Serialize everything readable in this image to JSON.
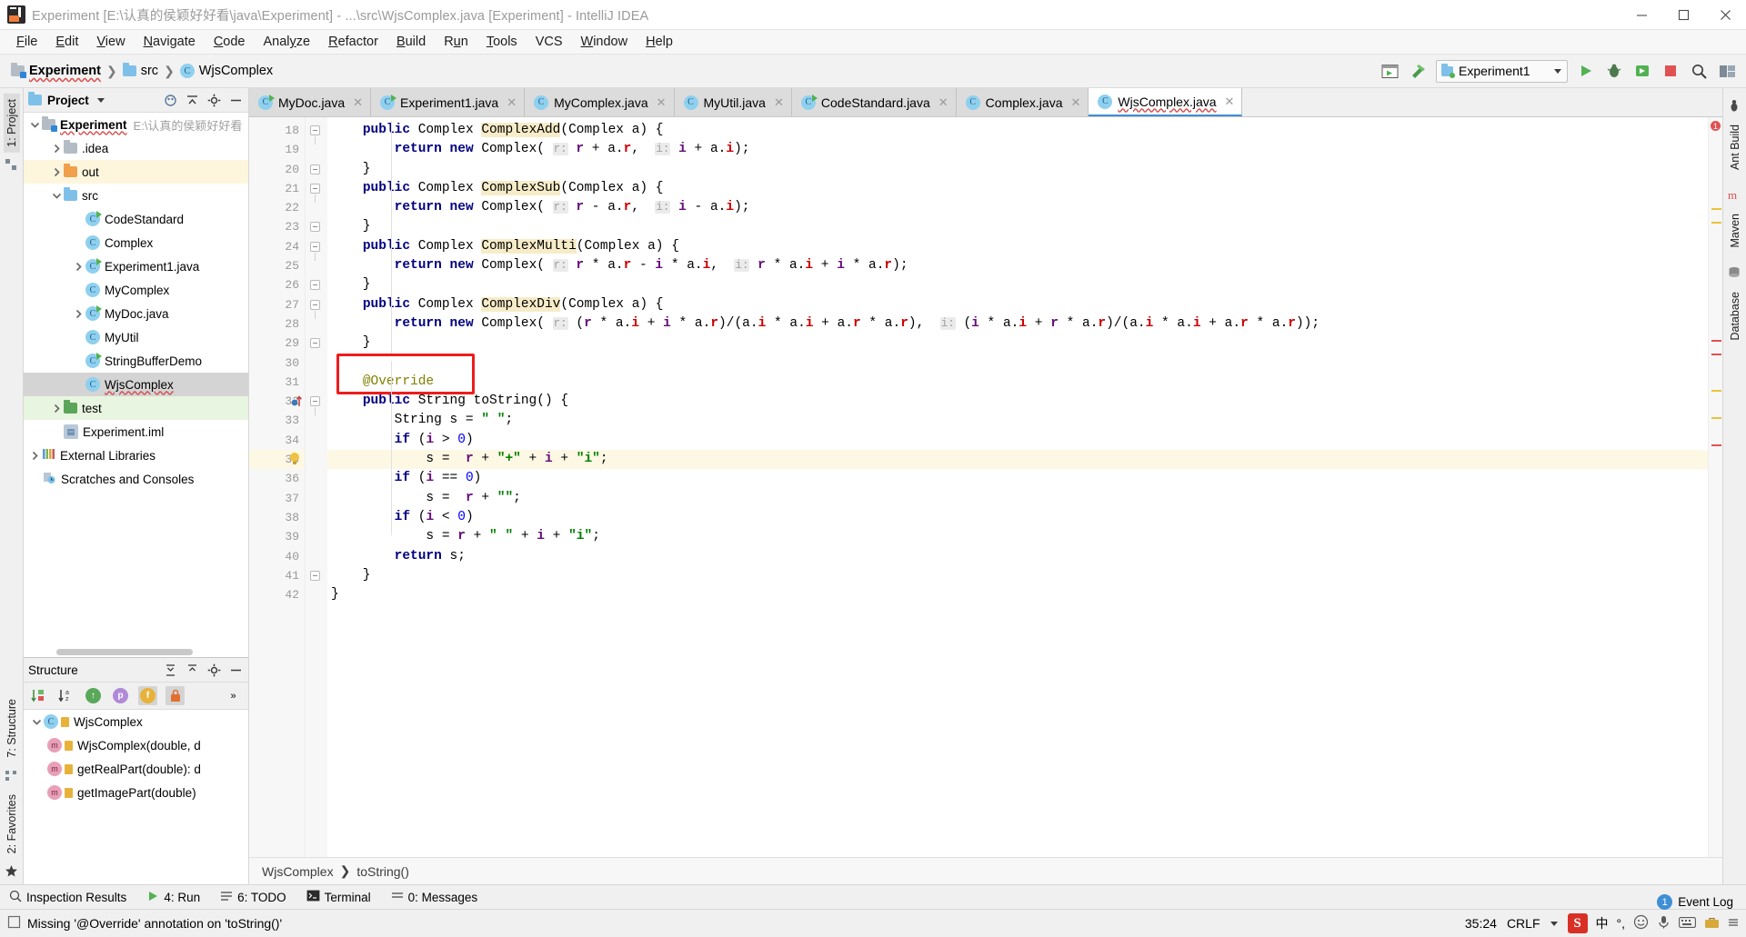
{
  "window": {
    "title": "Experiment [E:\\认真的侯颖好好看\\java\\Experiment] - ...\\src\\WjsComplex.java [Experiment] - IntelliJ IDEA",
    "minimize": "—",
    "maximize": "▢",
    "close": "✕"
  },
  "menu": [
    "File",
    "Edit",
    "View",
    "Navigate",
    "Code",
    "Analyze",
    "Refactor",
    "Build",
    "Run",
    "Tools",
    "VCS",
    "Window",
    "Help"
  ],
  "navbar": {
    "crumbs": [
      "Experiment",
      "src",
      "WjsComplex"
    ],
    "run_config": "Experiment1"
  },
  "left_strips": {
    "top": [
      "1: Project",
      "7: Structure",
      "2: Favorites"
    ],
    "right": [
      "Ant Build",
      "Maven",
      "Database"
    ]
  },
  "project": {
    "title": "Project",
    "root": {
      "label": "Experiment",
      "path": "E:\\认真的侯颖好好看"
    },
    "items": [
      {
        "label": ".idea",
        "type": "folder-gray",
        "arrow": "collapsed",
        "indent": 1
      },
      {
        "label": "out",
        "type": "folder-orange",
        "arrow": "collapsed",
        "indent": 1,
        "highlight": "yellow"
      },
      {
        "label": "src",
        "type": "folder-blue",
        "arrow": "expanded",
        "indent": 1
      },
      {
        "label": "CodeStandard",
        "type": "class-run",
        "arrow": "none",
        "indent": 2
      },
      {
        "label": "Complex",
        "type": "class",
        "arrow": "none",
        "indent": 2
      },
      {
        "label": "Experiment1.java",
        "type": "class-run",
        "arrow": "collapsed",
        "indent": 2
      },
      {
        "label": "MyComplex",
        "type": "class",
        "arrow": "none",
        "indent": 2
      },
      {
        "label": "MyDoc.java",
        "type": "class-run",
        "arrow": "collapsed",
        "indent": 2
      },
      {
        "label": "MyUtil",
        "type": "class",
        "arrow": "none",
        "indent": 2
      },
      {
        "label": "StringBufferDemo",
        "type": "class-run",
        "arrow": "none",
        "indent": 2
      },
      {
        "label": "WjsComplex",
        "type": "class",
        "arrow": "none",
        "indent": 2,
        "highlight": "gray",
        "squiggle": true
      },
      {
        "label": "test",
        "type": "folder-green",
        "arrow": "collapsed",
        "indent": 1,
        "highlight": "green"
      },
      {
        "label": "Experiment.iml",
        "type": "iml",
        "arrow": "none",
        "indent": 1
      },
      {
        "label": "External Libraries",
        "type": "library",
        "arrow": "collapsed",
        "indent": 0
      },
      {
        "label": "Scratches and Consoles",
        "type": "scratch",
        "arrow": "none",
        "indent": 0
      }
    ]
  },
  "structure": {
    "title": "Structure",
    "items": [
      {
        "label": "WjsComplex",
        "type": "class"
      },
      {
        "label": "WjsComplex(double, d",
        "type": "method"
      },
      {
        "label": "getRealPart(double): d",
        "type": "method"
      },
      {
        "label": "getImagePart(double)",
        "type": "method"
      }
    ]
  },
  "tabs": [
    {
      "label": "MyDoc.java",
      "icon": "class-run",
      "active": false
    },
    {
      "label": "Experiment1.java",
      "icon": "class-run",
      "active": false
    },
    {
      "label": "MyComplex.java",
      "icon": "class",
      "active": false
    },
    {
      "label": "MyUtil.java",
      "icon": "class",
      "active": false
    },
    {
      "label": "CodeStandard.java",
      "icon": "class-run",
      "active": false
    },
    {
      "label": "Complex.java",
      "icon": "class",
      "active": false
    },
    {
      "label": "WjsComplex.java",
      "icon": "class",
      "active": true,
      "squiggle": true
    }
  ],
  "editor": {
    "first_line": 18,
    "current_line": 35,
    "lines": [
      {
        "n": 18,
        "fold": "open",
        "html": "    <span class='kw'>public</span> Complex <span class='mth'>ComplexAdd</span>(Complex a) {"
      },
      {
        "n": 19,
        "fold": "none",
        "html": "        <span class='kw'>return</span> <span class='kw'>new</span> Complex( <span class='hint'>r:</span> <span class='fld'>r</span> + a.<span class='fldr'>r</span>,  <span class='hint'>i:</span> <span class='fld'>i</span> + a.<span class='fldr'>i</span>);"
      },
      {
        "n": 20,
        "fold": "close",
        "html": "    }"
      },
      {
        "n": 21,
        "fold": "open",
        "html": "    <span class='kw'>public</span> Complex <span class='mth'>ComplexSub</span>(Complex a) {"
      },
      {
        "n": 22,
        "fold": "none",
        "html": "        <span class='kw'>return</span> <span class='kw'>new</span> Complex( <span class='hint'>r:</span> <span class='fld'>r</span> - a.<span class='fldr'>r</span>,  <span class='hint'>i:</span> <span class='fld'>i</span> - a.<span class='fldr'>i</span>);"
      },
      {
        "n": 23,
        "fold": "close",
        "html": "    }"
      },
      {
        "n": 24,
        "fold": "open",
        "html": "    <span class='kw'>public</span> Complex <span class='mth'>ComplexMulti</span>(Complex a) {"
      },
      {
        "n": 25,
        "fold": "none",
        "html": "        <span class='kw'>return</span> <span class='kw'>new</span> Complex( <span class='hint'>r:</span> <span class='fld'>r</span> * a.<span class='fldr'>r</span> - <span class='fld'>i</span> * a.<span class='fldr'>i</span>,  <span class='hint'>i:</span> <span class='fld'>r</span> * a.<span class='fldr'>i</span> + <span class='fld'>i</span> * a.<span class='fldr'>r</span>);"
      },
      {
        "n": 26,
        "fold": "close",
        "html": "    }"
      },
      {
        "n": 27,
        "fold": "open",
        "html": "    <span class='kw'>public</span> Complex <span class='mth'>ComplexDiv</span>(Complex a) {"
      },
      {
        "n": 28,
        "fold": "none",
        "html": "        <span class='kw'>return</span> <span class='kw'>new</span> Complex( <span class='hint'>r:</span> (<span class='fld'>r</span> * a.<span class='fldr'>i</span> + <span class='fld'>i</span> * a.<span class='fldr'>r</span>)/(a.<span class='fldr'>i</span> * a.<span class='fldr'>i</span> + a.<span class='fldr'>r</span> * a.<span class='fldr'>r</span>),  <span class='hint'>i:</span> (<span class='fld'>i</span> * a.<span class='fldr'>i</span> + <span class='fld'>r</span> * a.<span class='fldr'>r</span>)/(a.<span class='fldr'>i</span> * a.<span class='fldr'>i</span> + a.<span class='fldr'>r</span> * a.<span class='fldr'>r</span>));"
      },
      {
        "n": 29,
        "fold": "close",
        "html": "    }"
      },
      {
        "n": 30,
        "fold": "none",
        "html": ""
      },
      {
        "n": 31,
        "fold": "none",
        "html": "    <span class='ann'>@Override</span>"
      },
      {
        "n": 32,
        "fold": "open",
        "html": "    <span class='kw'>public</span> String toString() {"
      },
      {
        "n": 33,
        "fold": "none",
        "html": "        String s = <span class='str'>\" \"</span>;"
      },
      {
        "n": 34,
        "fold": "none",
        "html": "        <span class='kw'>if</span> (<span class='fld'>i</span> &gt; <span class='num'>0</span>)"
      },
      {
        "n": 35,
        "fold": "none",
        "html": "            s =  <span class='fld'>r</span> + <span class='str'>\"+\"</span> + <span class='fld'>i</span> + <span class='str'>\"i\"</span>;"
      },
      {
        "n": 36,
        "fold": "none",
        "html": "        <span class='kw'>if</span> (<span class='fld'>i</span> == <span class='num'>0</span>)"
      },
      {
        "n": 37,
        "fold": "none",
        "html": "            s =  <span class='fld'>r</span> + <span class='str'>\"\"</span>;"
      },
      {
        "n": 38,
        "fold": "none",
        "html": "        <span class='kw'>if</span> (<span class='fld'>i</span> &lt; <span class='num'>0</span>)"
      },
      {
        "n": 39,
        "fold": "none",
        "html": "            s = <span class='fld'>r</span> + <span class='str'>\" \"</span> + <span class='fld'>i</span> + <span class='str'>\"i\"</span>;"
      },
      {
        "n": 40,
        "fold": "none",
        "html": "        <span class='kw'>return</span> s;"
      },
      {
        "n": 41,
        "fold": "close",
        "html": "    }"
      },
      {
        "n": 42,
        "fold": "none",
        "html": "}"
      }
    ],
    "annotation_label": "@Override",
    "annotation_color": "#ee1c1c",
    "error_count": "1"
  },
  "editor_breadcrumb": [
    "WjsComplex",
    "toString()"
  ],
  "toolwindows": [
    {
      "label": "Inspection Results",
      "icon": "inspection-icon"
    },
    {
      "label": "4: Run",
      "icon": "run-icon"
    },
    {
      "label": "6: TODO",
      "icon": "todo-icon"
    },
    {
      "label": "Terminal",
      "icon": "terminal-icon"
    },
    {
      "label": "0: Messages",
      "icon": "messages-icon"
    }
  ],
  "status": {
    "message": "Missing '@Override' annotation on 'toString()'",
    "caret": "35:24",
    "line_sep": "CRLF",
    "event_log": "Event Log",
    "event_count": "1",
    "ime_logo": "S",
    "ime_lang": "中"
  }
}
